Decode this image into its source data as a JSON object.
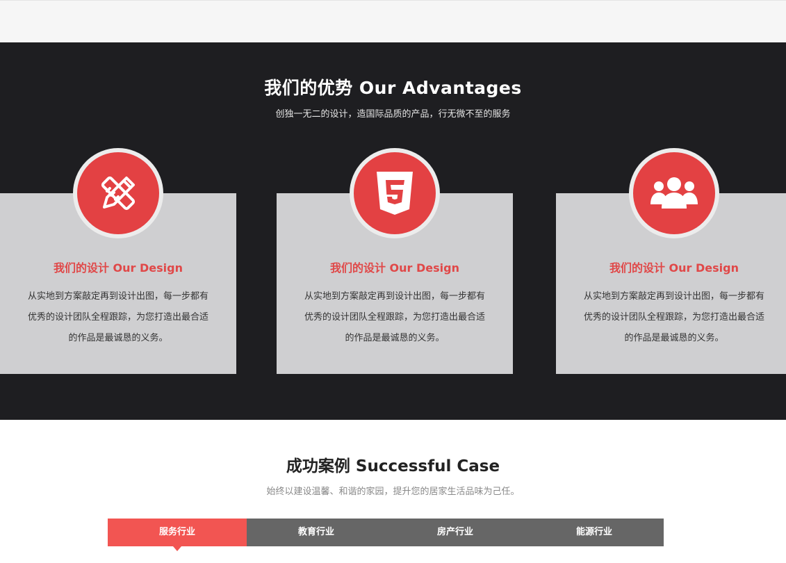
{
  "advantages": {
    "title": "我们的优势 Our Advantages",
    "subtitle": "创独一无二的设计，造国际品质的产品，行无微不至的服务",
    "cards": [
      {
        "icon": "pencil-ruler-icon",
        "title": "我们的设计 Our Design",
        "text": "从实地到方案敲定再到设计出图，每一步都有优秀的设计团队全程跟踪，为您打造出最合适的作品是最诚恳的义务。"
      },
      {
        "icon": "html5-icon",
        "title": "我们的设计 Our Design",
        "text": "从实地到方案敲定再到设计出图，每一步都有优秀的设计团队全程跟踪，为您打造出最合适的作品是最诚恳的义务。"
      },
      {
        "icon": "users-icon",
        "title": "我们的设计 Our Design",
        "text": "从实地到方案敲定再到设计出图，每一步都有优秀的设计团队全程跟踪，为您打造出最合适的作品是最诚恳的义务。"
      }
    ]
  },
  "cases": {
    "title": "成功案例 Successful Case",
    "subtitle": "始终以建设温馨、和谐的家园，提升您的居家生活品味为己任。",
    "tabs": [
      {
        "label": "服务行业",
        "active": true
      },
      {
        "label": "教育行业",
        "active": false
      },
      {
        "label": "房产行业",
        "active": false
      },
      {
        "label": "能源行业",
        "active": false
      }
    ]
  },
  "colors": {
    "accent": "#e34143",
    "dark_bg": "#1e1e21",
    "card_bg": "#cfcfd1",
    "tab_bg": "#666666",
    "tab_active": "#f25552"
  }
}
